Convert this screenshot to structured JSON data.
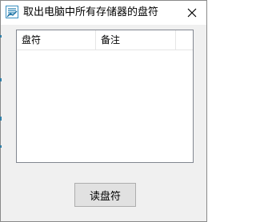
{
  "window": {
    "title": "取出电脑中所有存储器的盘符",
    "app_icon": "app-logo-icon",
    "close_icon": "close-icon"
  },
  "list": {
    "columns": [
      "盘符",
      "备注",
      ""
    ],
    "rows": []
  },
  "buttons": {
    "read_label": "读盘符"
  },
  "colors": {
    "window_bg": "#f0f0f0",
    "titlebar_bg": "#ffffff",
    "button_bg": "#e1e1e1",
    "button_border": "#adadad",
    "list_border": "#828790"
  }
}
